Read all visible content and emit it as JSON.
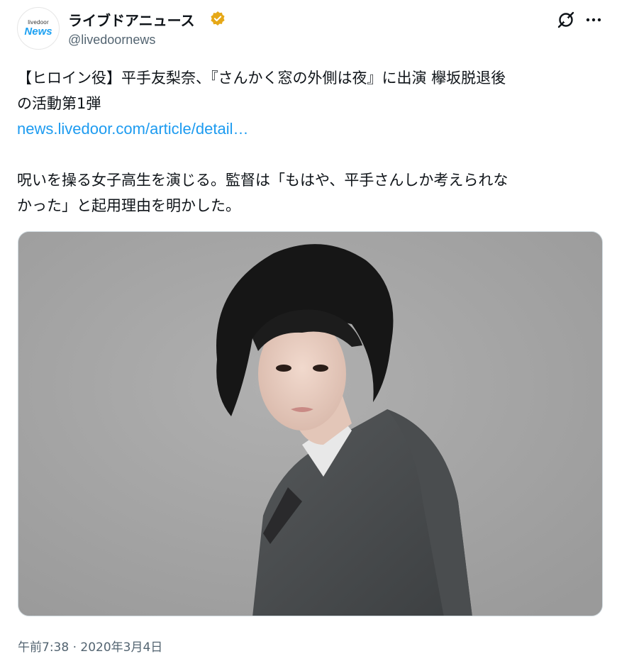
{
  "author": {
    "display_name": "ライブドアニュース",
    "handle": "@livedoornews",
    "avatar_logo_top": "livedoor",
    "avatar_logo_main": "News",
    "verified_badge_icon": "verified-badge-icon",
    "badge_color": "#e6a817"
  },
  "header_actions": {
    "grok_icon": "grok-icon",
    "more_icon": "more-icon"
  },
  "text": {
    "line1": "【ヒロイン役】平手友梨奈、『さんかく窓の外側は夜』に出演 欅坂脱退後",
    "line2": "の活動第1弾",
    "link": "news.livedoor.com/article/detail…",
    "line3": "呪いを操る女子高生を演じる。監督は「もはや、平手さんしか考えられな",
    "line4": "かった」と起用理由を明かした。"
  },
  "timestamp": "午前7:38 · 2020年3月4日",
  "colors": {
    "link": "#1d9bf0",
    "secondary_text": "#536471",
    "photo_background": "#a7a7a7"
  }
}
